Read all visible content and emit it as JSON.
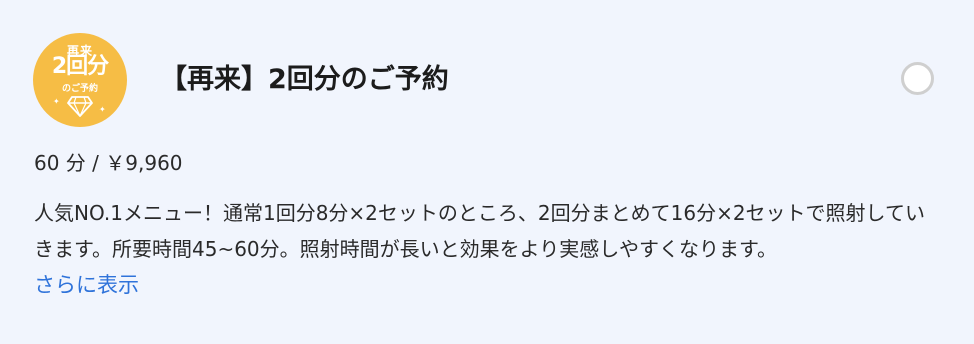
{
  "badge": {
    "top_text": "再来",
    "main_text": "2回分",
    "sub_text": "のご予約",
    "icon": "diamond-icon",
    "color": "#f6bd45"
  },
  "title": "【再来】2回分のご予約",
  "meta": "60 分 / ￥9,960",
  "description": "人気NO.1メニュー！通常1回分8分×2セットのところ、2回分まとめて16分×2セットで照射していきます。所要時間45~60分。照射時間が長いと効果をより実感しやすくなります。",
  "show_more": "さらに表示",
  "colors": {
    "background": "#f1f5fd",
    "link": "#2f73da",
    "radio_border": "#cfcfcf"
  }
}
